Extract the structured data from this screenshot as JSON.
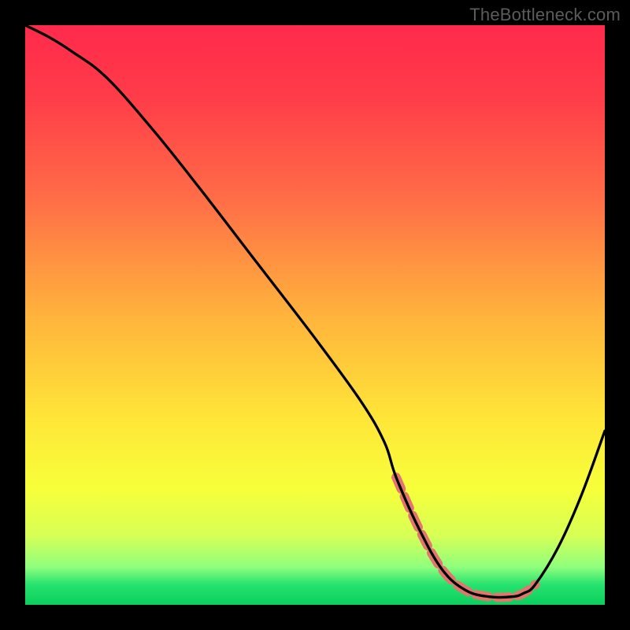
{
  "watermark": "TheBottleneck.com",
  "chart_data": {
    "type": "line",
    "title": "",
    "xlabel": "",
    "ylabel": "",
    "xlim": [
      0,
      100
    ],
    "ylim": [
      0,
      100
    ],
    "gradient_stops": [
      {
        "pos": 0.0,
        "color": "#ff2a4c"
      },
      {
        "pos": 0.12,
        "color": "#ff3b49"
      },
      {
        "pos": 0.3,
        "color": "#ff6d47"
      },
      {
        "pos": 0.5,
        "color": "#ffb33c"
      },
      {
        "pos": 0.68,
        "color": "#ffe638"
      },
      {
        "pos": 0.8,
        "color": "#f7ff3a"
      },
      {
        "pos": 0.88,
        "color": "#d7ff55"
      },
      {
        "pos": 0.935,
        "color": "#8fff7d"
      },
      {
        "pos": 0.965,
        "color": "#27e26e"
      },
      {
        "pos": 1.0,
        "color": "#0bcf5f"
      }
    ],
    "series": [
      {
        "name": "curve",
        "color": "#000000",
        "x": [
          0,
          4,
          8,
          14,
          22,
          30,
          40,
          50,
          58,
          62,
          64,
          68,
          72,
          76,
          80,
          84,
          86,
          88,
          92,
          96,
          100
        ],
        "y": [
          100,
          98,
          95.5,
          91,
          82,
          72,
          59,
          46,
          35,
          28,
          22,
          13,
          6,
          2.5,
          1.4,
          1.4,
          2.0,
          3.5,
          10,
          19,
          30
        ]
      },
      {
        "name": "marker-band",
        "color": "#e2766d",
        "x": [
          64,
          68,
          72,
          76,
          80,
          84,
          86,
          88
        ],
        "y": [
          22,
          13,
          6,
          2.5,
          1.4,
          1.4,
          2.0,
          3.5
        ]
      }
    ]
  }
}
